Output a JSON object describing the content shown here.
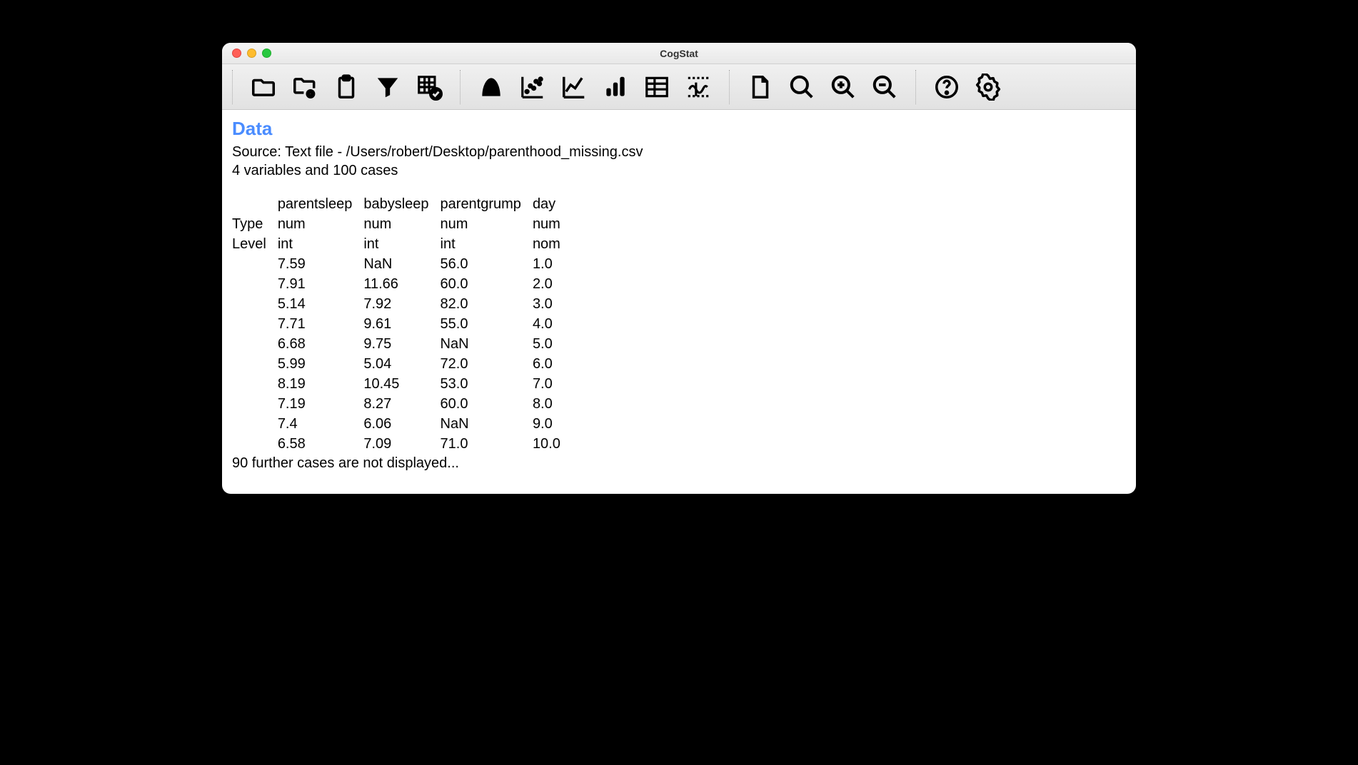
{
  "window": {
    "title": "CogStat"
  },
  "toolbar": {
    "groups": [
      [
        "folder-open-icon",
        "folder-find-icon",
        "clipboard-icon",
        "filter-icon",
        "pivot-check-icon"
      ],
      [
        "distribution-icon",
        "scatter-icon",
        "line-chart-icon",
        "bar-chart-icon",
        "table-icon",
        "mixed-chart-icon"
      ],
      [
        "document-icon",
        "search-icon",
        "zoom-in-icon",
        "zoom-out-icon"
      ],
      [
        "help-icon",
        "settings-icon"
      ]
    ]
  },
  "content": {
    "heading": "Data",
    "source": "Source: Text file - /Users/robert/Desktop/parenthood_missing.csv",
    "summary": "4 variables and 100 cases",
    "truncated": "90 further cases are not displayed...",
    "table": {
      "row_labels": [
        "Type",
        "Level"
      ],
      "columns": [
        "parentsleep",
        "babysleep",
        "parentgrump",
        "day"
      ],
      "type_row": [
        "num",
        "num",
        "num",
        "num"
      ],
      "level_row": [
        "int",
        "int",
        "int",
        "nom"
      ],
      "rows": [
        [
          "7.59",
          "NaN",
          "56.0",
          "1.0"
        ],
        [
          "7.91",
          "11.66",
          "60.0",
          "2.0"
        ],
        [
          "5.14",
          "7.92",
          "82.0",
          "3.0"
        ],
        [
          "7.71",
          "9.61",
          "55.0",
          "4.0"
        ],
        [
          "6.68",
          "9.75",
          "NaN",
          "5.0"
        ],
        [
          "5.99",
          "5.04",
          "72.0",
          "6.0"
        ],
        [
          "8.19",
          "10.45",
          "53.0",
          "7.0"
        ],
        [
          "7.19",
          "8.27",
          "60.0",
          "8.0"
        ],
        [
          "7.4",
          "6.06",
          "NaN",
          "9.0"
        ],
        [
          "6.58",
          "7.09",
          "71.0",
          "10.0"
        ]
      ]
    }
  }
}
